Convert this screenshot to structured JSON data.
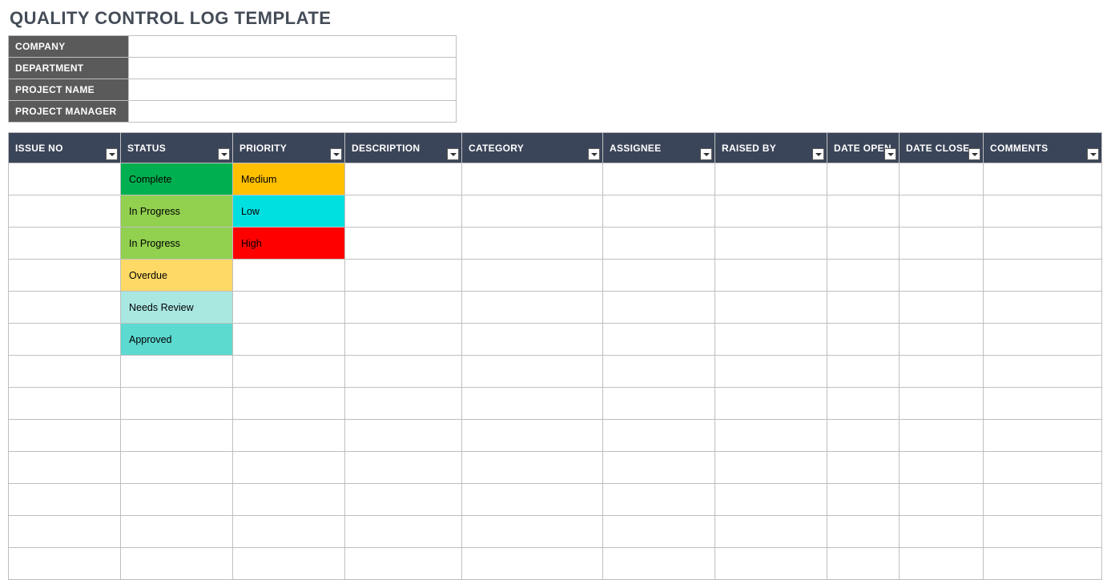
{
  "title": "QUALITY CONTROL LOG TEMPLATE",
  "info": {
    "labels": {
      "company": "COMPANY",
      "department": "DEPARTMENT",
      "project_name": "PROJECT NAME",
      "project_manager": "PROJECT MANAGER"
    },
    "values": {
      "company": "",
      "department": "",
      "project_name": "",
      "project_manager": ""
    }
  },
  "columns": {
    "issue_no": "ISSUE NO",
    "status": "STATUS",
    "priority": "PRIORITY",
    "description": "DESCRIPTION",
    "category": "CATEGORY",
    "assignee": "ASSIGNEE",
    "raised_by": "RAISED BY",
    "date_open": "DATE OPEN",
    "date_close": "DATE CLOSE",
    "comments": "COMMENTS"
  },
  "status_colors": {
    "Complete": "#00b050",
    "In Progress": "#92d050",
    "Overdue": "#ffd966",
    "Needs Review": "#a9e8e1",
    "Approved": "#5ddad0"
  },
  "priority_colors": {
    "Medium": "#ffc000",
    "Low": "#00e0e0",
    "High": "#ff0000"
  },
  "rows": [
    {
      "issue_no": "",
      "status": "Complete",
      "priority": "Medium",
      "description": "",
      "category": "",
      "assignee": "",
      "raised_by": "",
      "date_open": "",
      "date_close": "",
      "comments": ""
    },
    {
      "issue_no": "",
      "status": "In Progress",
      "priority": "Low",
      "description": "",
      "category": "",
      "assignee": "",
      "raised_by": "",
      "date_open": "",
      "date_close": "",
      "comments": ""
    },
    {
      "issue_no": "",
      "status": "In Progress",
      "priority": "High",
      "description": "",
      "category": "",
      "assignee": "",
      "raised_by": "",
      "date_open": "",
      "date_close": "",
      "comments": ""
    },
    {
      "issue_no": "",
      "status": "Overdue",
      "priority": "",
      "description": "",
      "category": "",
      "assignee": "",
      "raised_by": "",
      "date_open": "",
      "date_close": "",
      "comments": ""
    },
    {
      "issue_no": "",
      "status": "Needs Review",
      "priority": "",
      "description": "",
      "category": "",
      "assignee": "",
      "raised_by": "",
      "date_open": "",
      "date_close": "",
      "comments": ""
    },
    {
      "issue_no": "",
      "status": "Approved",
      "priority": "",
      "description": "",
      "category": "",
      "assignee": "",
      "raised_by": "",
      "date_open": "",
      "date_close": "",
      "comments": ""
    },
    {
      "issue_no": "",
      "status": "",
      "priority": "",
      "description": "",
      "category": "",
      "assignee": "",
      "raised_by": "",
      "date_open": "",
      "date_close": "",
      "comments": ""
    },
    {
      "issue_no": "",
      "status": "",
      "priority": "",
      "description": "",
      "category": "",
      "assignee": "",
      "raised_by": "",
      "date_open": "",
      "date_close": "",
      "comments": ""
    },
    {
      "issue_no": "",
      "status": "",
      "priority": "",
      "description": "",
      "category": "",
      "assignee": "",
      "raised_by": "",
      "date_open": "",
      "date_close": "",
      "comments": ""
    },
    {
      "issue_no": "",
      "status": "",
      "priority": "",
      "description": "",
      "category": "",
      "assignee": "",
      "raised_by": "",
      "date_open": "",
      "date_close": "",
      "comments": ""
    },
    {
      "issue_no": "",
      "status": "",
      "priority": "",
      "description": "",
      "category": "",
      "assignee": "",
      "raised_by": "",
      "date_open": "",
      "date_close": "",
      "comments": ""
    },
    {
      "issue_no": "",
      "status": "",
      "priority": "",
      "description": "",
      "category": "",
      "assignee": "",
      "raised_by": "",
      "date_open": "",
      "date_close": "",
      "comments": ""
    },
    {
      "issue_no": "",
      "status": "",
      "priority": "",
      "description": "",
      "category": "",
      "assignee": "",
      "raised_by": "",
      "date_open": "",
      "date_close": "",
      "comments": ""
    }
  ]
}
